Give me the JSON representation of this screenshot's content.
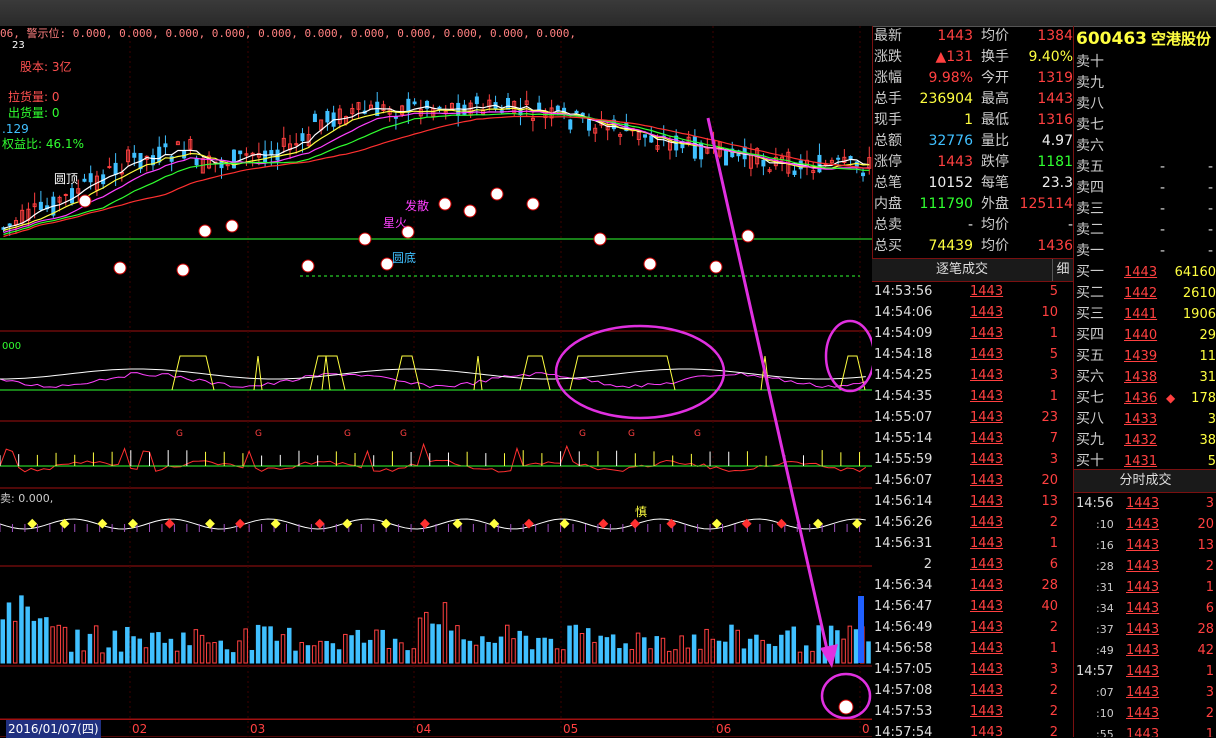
{
  "chart_header": {
    "prefix": "06, 警示位: 0.000, 0.000, 0.000, 0.000, 0.000, 0.000, 0.000, 0.000, 0.000, 0.000, 0.000,",
    "price_label": "23",
    "left_texts": [
      {
        "text": "股本: 3亿",
        "color": "#ff5050"
      },
      {
        "text": "拉货量: 0",
        "color": "#ff5050"
      },
      {
        "text": "出货量: 0",
        "color": "#30ff30"
      },
      {
        "text": ".129",
        "color": "#40c0ff"
      },
      {
        "text": "权益比: 46.1%",
        "color": "#30ff30"
      }
    ]
  },
  "annotations": [
    {
      "text": "圆顶",
      "color": "#ffffff"
    },
    {
      "text": "发散",
      "color": "#ff40ff"
    },
    {
      "text": "星火",
      "color": "#ff40ff"
    },
    {
      "text": "圆底",
      "color": "#40c0ff"
    }
  ],
  "sub_labels": {
    "panel2_label": "000",
    "panel4_label": "卖: 0.000,",
    "panel4_char": "慎"
  },
  "date_axis": {
    "start_date": "2016/01/07(四)",
    "months": [
      "02",
      "03",
      "04",
      "05",
      "06",
      "0"
    ]
  },
  "info_panel": {
    "rows": [
      {
        "l1": "最新",
        "v1": "1443",
        "c1": "#ff4040",
        "l2": "均价",
        "v2": "1384",
        "c2": "#ff4040"
      },
      {
        "l1": "涨跌",
        "v1": "▲131",
        "c1": "#ff4040",
        "l2": "换手",
        "v2": "9.40%",
        "c2": "#ffff40"
      },
      {
        "l1": "涨幅",
        "v1": "9.98%",
        "c1": "#ff4040",
        "l2": "今开",
        "v2": "1319",
        "c2": "#ff4040"
      },
      {
        "l1": "总手",
        "v1": "236904",
        "c1": "#ffff40",
        "l2": "最高",
        "v2": "1443",
        "c2": "#ff4040"
      },
      {
        "l1": "现手",
        "v1": "1",
        "c1": "#ffff40",
        "l2": "最低",
        "v2": "1316",
        "c2": "#ff4040"
      },
      {
        "l1": "总额",
        "v1": "32776",
        "c1": "#40c0ff",
        "l2": "量比",
        "v2": "4.97",
        "c2": "#eeeeee"
      },
      {
        "l1": "涨停",
        "v1": "1443",
        "c1": "#ff4040",
        "l2": "跌停",
        "v2": "1181",
        "c2": "#30ff30"
      },
      {
        "l1": "总笔",
        "v1": "10152",
        "c1": "#eeeeee",
        "l2": "每笔",
        "v2": "23.3",
        "c2": "#eeeeee"
      },
      {
        "l1": "内盘",
        "v1": "111790",
        "c1": "#30ff30",
        "l2": "外盘",
        "v2": "125114",
        "c2": "#ff4040"
      },
      {
        "l1": "总卖",
        "v1": "-",
        "c1": "#eeeeee",
        "l2": "均价",
        "v2": "-",
        "c2": "#eeeeee"
      },
      {
        "l1": "总买",
        "v1": "74439",
        "c1": "#ffff40",
        "l2": "均价",
        "v2": "1436",
        "c2": "#ff4040"
      }
    ]
  },
  "trade_panel": {
    "title": "逐笔成交",
    "detail_button": "细",
    "rows": [
      {
        "time": "14:53:56",
        "price": "1443",
        "vol": "5",
        "vc": "#ff4040"
      },
      {
        "time": "14:54:06",
        "price": "1443",
        "vol": "10",
        "vc": "#ff4040"
      },
      {
        "time": "14:54:09",
        "price": "1443",
        "vol": "1",
        "vc": "#ff4040"
      },
      {
        "time": "14:54:18",
        "price": "1443",
        "vol": "5",
        "vc": "#ff4040"
      },
      {
        "time": "14:54:25",
        "price": "1443",
        "vol": "3",
        "vc": "#ff4040"
      },
      {
        "time": "14:54:35",
        "price": "1443",
        "vol": "1",
        "vc": "#ff4040"
      },
      {
        "time": "14:55:07",
        "price": "1443",
        "vol": "23",
        "vc": "#ff4040"
      },
      {
        "time": "14:55:14",
        "price": "1443",
        "vol": "7",
        "vc": "#ff4040"
      },
      {
        "time": "14:55:59",
        "price": "1443",
        "vol": "3",
        "vc": "#ff4040"
      },
      {
        "time": "14:56:07",
        "price": "1443",
        "vol": "20",
        "vc": "#ff4040"
      },
      {
        "time": "14:56:14",
        "price": "1443",
        "vol": "13",
        "vc": "#ff4040"
      },
      {
        "time": "14:56:26",
        "price": "1443",
        "vol": "2",
        "vc": "#ff4040"
      },
      {
        "time": "14:56:31",
        "price": "1443",
        "vol": "1",
        "vc": "#ff4040"
      },
      {
        "time": "2",
        "price": "1443",
        "vol": "6",
        "vc": "#ff4040"
      },
      {
        "time": "14:56:34",
        "price": "1443",
        "vol": "28",
        "vc": "#ff4040"
      },
      {
        "time": "14:56:47",
        "price": "1443",
        "vol": "40",
        "vc": "#ff4040"
      },
      {
        "time": "14:56:49",
        "price": "1443",
        "vol": "2",
        "vc": "#ff4040"
      },
      {
        "time": "14:56:58",
        "price": "1443",
        "vol": "1",
        "vc": "#ff4040"
      },
      {
        "time": "14:57:05",
        "price": "1443",
        "vol": "3",
        "vc": "#ff4040"
      },
      {
        "time": "14:57:08",
        "price": "1443",
        "vol": "2",
        "vc": "#ff4040"
      },
      {
        "time": "14:57:53",
        "price": "1443",
        "vol": "2",
        "vc": "#ff4040"
      },
      {
        "time": "14:57:54",
        "price": "1443",
        "vol": "2",
        "vc": "#ff4040"
      }
    ]
  },
  "order_book": {
    "code": "600463",
    "name": "空港股份",
    "sell": [
      {
        "label": "卖十",
        "price": "",
        "vol": ""
      },
      {
        "label": "卖九",
        "price": "",
        "vol": ""
      },
      {
        "label": "卖八",
        "price": "",
        "vol": ""
      },
      {
        "label": "卖七",
        "price": "",
        "vol": ""
      },
      {
        "label": "卖六",
        "price": "",
        "vol": ""
      },
      {
        "label": "卖五",
        "price": "-",
        "vol": "-"
      },
      {
        "label": "卖四",
        "price": "-",
        "vol": "-"
      },
      {
        "label": "卖三",
        "price": "-",
        "vol": "-"
      },
      {
        "label": "卖二",
        "price": "-",
        "vol": "-"
      },
      {
        "label": "卖一",
        "price": "-",
        "vol": "-"
      }
    ],
    "buy": [
      {
        "label": "买一",
        "price": "1443",
        "vol": "64160",
        "mark": ""
      },
      {
        "label": "买二",
        "price": "1442",
        "vol": "2610",
        "mark": ""
      },
      {
        "label": "买三",
        "price": "1441",
        "vol": "1906",
        "mark": ""
      },
      {
        "label": "买四",
        "price": "1440",
        "vol": "29",
        "mark": ""
      },
      {
        "label": "买五",
        "price": "1439",
        "vol": "11",
        "mark": ""
      },
      {
        "label": "买六",
        "price": "1438",
        "vol": "31",
        "mark": ""
      },
      {
        "label": "买七",
        "price": "1436",
        "vol": "178",
        "mark": "◆"
      },
      {
        "label": "买八",
        "price": "1433",
        "vol": "3",
        "mark": ""
      },
      {
        "label": "买九",
        "price": "1432",
        "vol": "38",
        "mark": ""
      },
      {
        "label": "买十",
        "price": "1431",
        "vol": "5",
        "mark": ""
      }
    ],
    "split_title": "分时成交",
    "split_rows": [
      {
        "time": "14:56",
        "price": "1443",
        "vol": "3"
      },
      {
        "time": ":10",
        "price": "1443",
        "vol": "20"
      },
      {
        "time": ":16",
        "price": "1443",
        "vol": "13"
      },
      {
        "time": ":28",
        "price": "1443",
        "vol": "2"
      },
      {
        "time": ":31",
        "price": "1443",
        "vol": "1"
      },
      {
        "time": ":34",
        "price": "1443",
        "vol": "6"
      },
      {
        "time": ":37",
        "price": "1443",
        "vol": "28"
      },
      {
        "time": ":49",
        "price": "1443",
        "vol": "42"
      },
      {
        "time": "14:57",
        "price": "1443",
        "vol": "1"
      },
      {
        "time": ":07",
        "price": "1443",
        "vol": "3"
      },
      {
        "time": ":10",
        "price": "1443",
        "vol": "2"
      },
      {
        "time": ":55",
        "price": "1443",
        "vol": "1"
      }
    ]
  },
  "colors": {
    "up": "#ff4040",
    "down": "#40c0ff",
    "accent": "#ff40ff",
    "grid": "#a01010",
    "yellow": "#ffff40",
    "green": "#30ff30"
  }
}
